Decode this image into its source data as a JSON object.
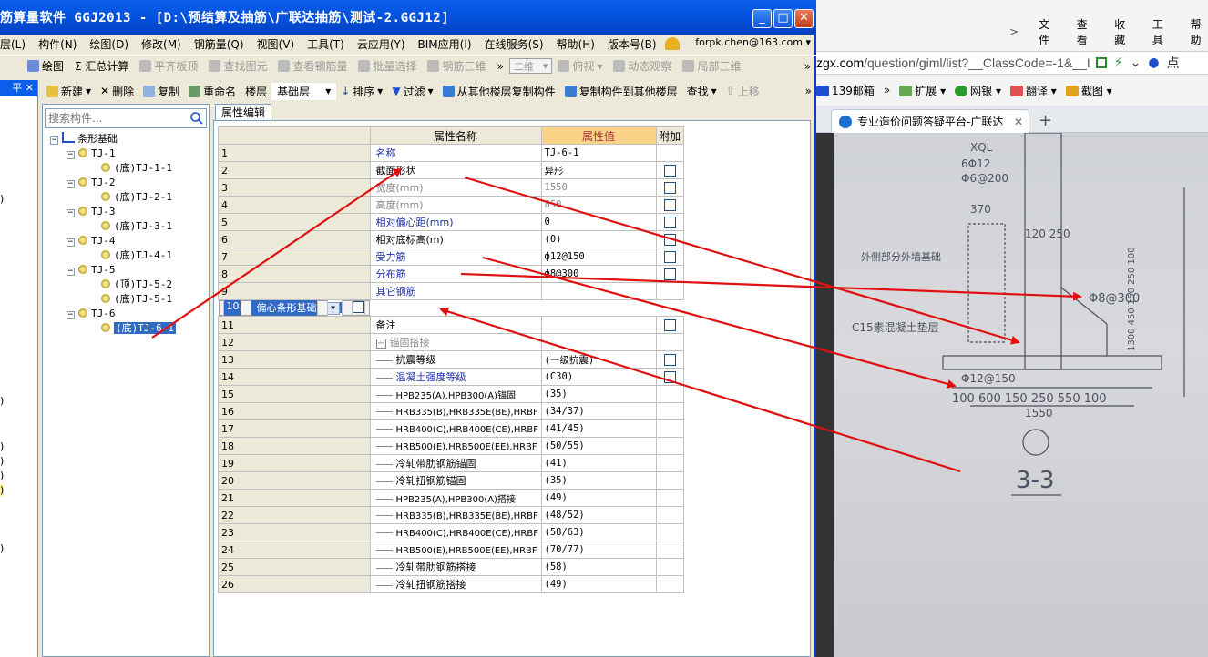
{
  "window": {
    "title": "筋算量软件 GGJ2013 - [D:\\预结算及抽筋\\广联达抽筋\\测试-2.GGJ12]",
    "minimize": "_",
    "maximize": "□",
    "close": "✕"
  },
  "menu": {
    "items": [
      "层(L)",
      "构件(N)",
      "绘图(D)",
      "修改(M)",
      "钢筋量(Q)",
      "视图(V)",
      "工具(T)",
      "云应用(Y)",
      "BIM应用(I)",
      "在线服务(S)",
      "帮助(H)",
      "版本号(B)"
    ],
    "account": "forpk.chen@163.com ▾"
  },
  "toolbar1": {
    "draw": "绘图",
    "sum": "Σ 汇总计算",
    "flat_top": "平齐板顶",
    "find": "查找图元",
    "view_rebar": "查看钢筋量",
    "batch_select": "批量选择",
    "rebar_3d": "钢筋三维",
    "more": "»",
    "view_mode": "二维",
    "overlook": "俯视",
    "dynamic": "动态观察",
    "local_3d": "局部三维",
    "more2": "»"
  },
  "toolbar2": {
    "new": "新建",
    "delete": "删除",
    "copy": "复制",
    "rename": "重命名",
    "floor": "楼层",
    "floor_value": "基础层",
    "sort": "排序",
    "filter": "过滤",
    "copy_from": "从其他楼层复制构件",
    "copy_to": "复制构件到其他楼层",
    "find": "查找",
    "move_up": "上移",
    "more": "»"
  },
  "left_panel": {
    "pin": "平 ✕",
    "marks": [
      ")",
      ")",
      ")",
      ")",
      ")",
      ")",
      ")"
    ]
  },
  "tree": {
    "search_placeholder": "搜索构件...",
    "root": "条形基础",
    "groups": [
      {
        "name": "TJ-1",
        "children": [
          "(底)TJ-1-1"
        ]
      },
      {
        "name": "TJ-2",
        "children": [
          "(底)TJ-2-1"
        ]
      },
      {
        "name": "TJ-3",
        "children": [
          "(底)TJ-3-1"
        ]
      },
      {
        "name": "TJ-4",
        "children": [
          "(底)TJ-4-1"
        ]
      },
      {
        "name": "TJ-5",
        "children": [
          "(顶)TJ-5-2",
          "(底)TJ-5-1"
        ]
      },
      {
        "name": "TJ-6",
        "children": [
          "(底)TJ-6-1"
        ]
      }
    ]
  },
  "props": {
    "tab": "属性编辑",
    "headers": {
      "name": "属性名称",
      "value": "属性值",
      "extra": "附加"
    },
    "rows": [
      {
        "n": "1",
        "name": "名称",
        "value": "TJ-6-1"
      },
      {
        "n": "2",
        "name": "截面形状",
        "value": "异形"
      },
      {
        "n": "3",
        "name": "宽度(mm)",
        "value": "1550"
      },
      {
        "n": "4",
        "name": "高度(mm)",
        "value": "850"
      },
      {
        "n": "5",
        "name": "相对偏心距(mm)",
        "value": "0"
      },
      {
        "n": "6",
        "name": "相对底标高(m)",
        "value": "(0)"
      },
      {
        "n": "7",
        "name": "受力筋",
        "value": "ф12@150"
      },
      {
        "n": "8",
        "name": "分布筋",
        "value": "ф8@300"
      },
      {
        "n": "9",
        "name": "其它钢筋",
        "value": ""
      },
      {
        "n": "10",
        "name": "偏心条形基础",
        "value": "是"
      },
      {
        "n": "11",
        "name": "备注",
        "value": ""
      },
      {
        "n": "12",
        "name": "锚固搭接",
        "value": ""
      },
      {
        "n": "13",
        "name": "抗震等级",
        "value": "(一级抗震)"
      },
      {
        "n": "14",
        "name": "混凝土强度等级",
        "value": "(C30)"
      },
      {
        "n": "15",
        "name": "HPB235(A),HPB300(A)锚固",
        "value": "(35)"
      },
      {
        "n": "16",
        "name": "HRB335(B),HRB335E(BE),HRBF",
        "value": "(34/37)"
      },
      {
        "n": "17",
        "name": "HRB400(C),HRB400E(CE),HRBF",
        "value": "(41/45)"
      },
      {
        "n": "18",
        "name": "HRB500(E),HRB500E(EE),HRBF",
        "value": "(50/55)"
      },
      {
        "n": "19",
        "name": "冷轧带肋钢筋锚固",
        "value": "(41)"
      },
      {
        "n": "20",
        "name": "冷轧扭钢筋锚固",
        "value": "(35)"
      },
      {
        "n": "21",
        "name": "HPB235(A),HPB300(A)搭接",
        "value": "(49)"
      },
      {
        "n": "22",
        "name": "HRB335(B),HRB335E(BE),HRBF",
        "value": "(48/52)"
      },
      {
        "n": "23",
        "name": "HRB400(C),HRB400E(CE),HRBF",
        "value": "(58/63)"
      },
      {
        "n": "24",
        "name": "HRB500(E),HRB500E(EE),HRBF",
        "value": "(70/77)"
      },
      {
        "n": "25",
        "name": "冷轧带肋钢筋搭接",
        "value": "(58)"
      },
      {
        "n": "26",
        "name": "冷轧扭钢筋搭接",
        "value": "(49)"
      }
    ]
  },
  "browser": {
    "menu": [
      "文件",
      "查看",
      "收藏",
      "工具",
      "帮助"
    ],
    "menu_arrow": ">",
    "url_host": "zgx.com",
    "url_path": "/question/giml/list?__ClassCode=-1&__I",
    "url_dots": "点",
    "fav": [
      "139邮箱",
      "»",
      "扩展",
      "网银",
      "翻译",
      "截图"
    ],
    "tab_title": "专业造价问题答疑平台-广联达",
    "tab_close": "✕",
    "new_tab": "+"
  },
  "drawing": {
    "labels": {
      "top": "XQL",
      "rebar_a": "6Φ12",
      "rebar_b": "Φ6@200",
      "dim_370": "370",
      "dim_120_250": "120 250",
      "note_1": "外侧部分外墙基础",
      "note_2": "C15素混凝土垫层",
      "dist_rebar": "Φ8@300",
      "main_rebar": "Φ12@150",
      "dims_bottom": "100 600 150 250 550 100",
      "total": "1550",
      "section": "3-3",
      "right_dims": "1300 450 150 250 100"
    }
  },
  "colors": {
    "title_blue": "#0554E0",
    "xp_face": "#ECE9D8",
    "select_blue": "#316AC5",
    "arrow_red": "#E01010",
    "header_orange": "#FAD389"
  }
}
